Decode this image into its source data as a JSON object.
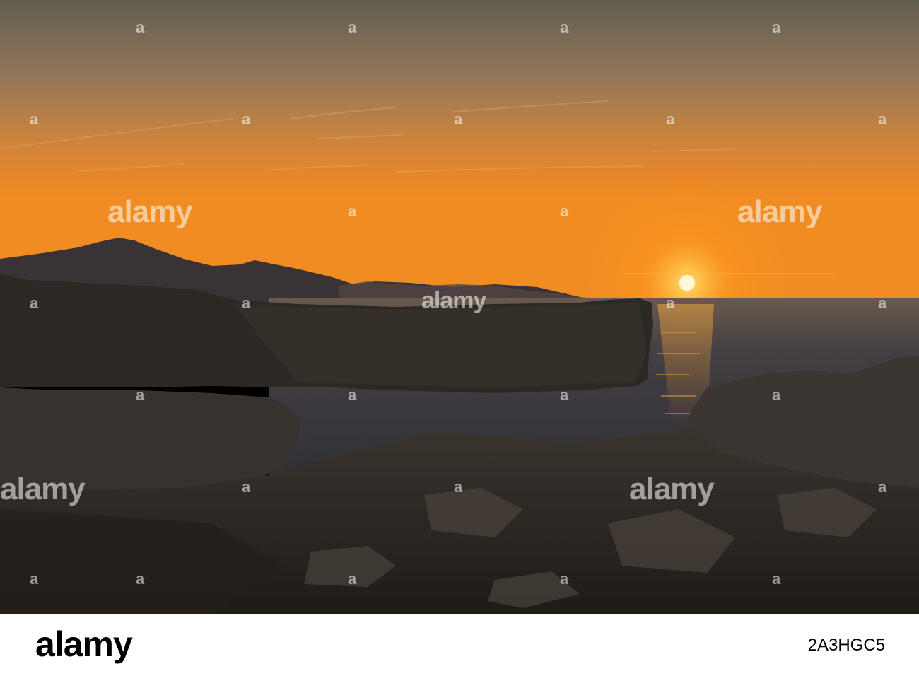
{
  "photo": {
    "subject": "sunset over rocky coastline with sea and mountains",
    "colors": {
      "sky_top": "#6e6855",
      "sky_mid": "#c88a48",
      "horizon": "#f08a1a",
      "sun": "#fff6c8",
      "sea": "#3c3d44",
      "rocks": "#2a2622"
    }
  },
  "watermark": {
    "brand": "alamy"
  },
  "footer": {
    "logo": "alamy",
    "image_id": "2A3HGC5"
  }
}
